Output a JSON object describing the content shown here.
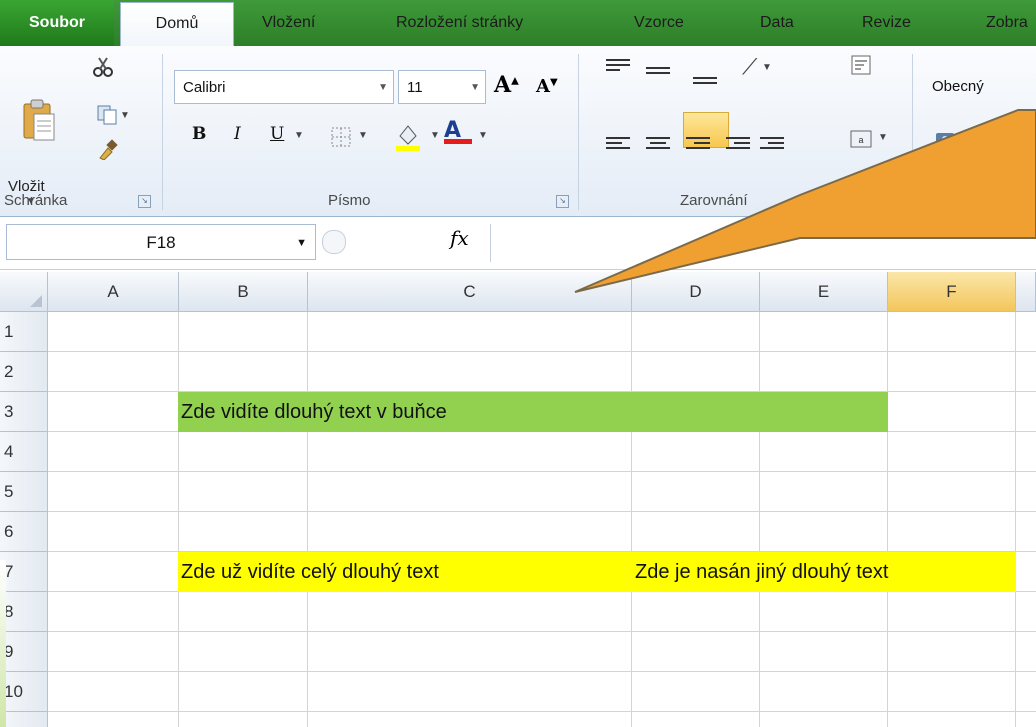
{
  "tabs": [
    "Soubor",
    "Domů",
    "Vložení",
    "Rozložení stránky",
    "Vzorce",
    "Data",
    "Revize",
    "Zobra"
  ],
  "ribbon": {
    "paste_label": "Vložit",
    "groups": {
      "clipboard": "Schránka",
      "font": "Písmo",
      "alignment": "Zarovnání"
    },
    "font_name": "Calibri",
    "font_size": "11",
    "number_format": "Obecný",
    "grow_font": "A",
    "shrink_font": "A",
    "bold": "B",
    "italic": "I",
    "underline": "U",
    "font_color_letter": "A"
  },
  "formula_bar": {
    "name_box": "F18",
    "fx": "fx",
    "formula": ""
  },
  "grid": {
    "columns": [
      "A",
      "B",
      "C",
      "D",
      "E",
      "F"
    ],
    "selected_column": "F",
    "rows": [
      "1",
      "2",
      "3",
      "4",
      "5",
      "6",
      "7",
      "8",
      "9",
      "10"
    ],
    "cells": {
      "b3": "Zde vidíte dlouhý text v buňce",
      "b7": "Zde už vidíte celý dlouhý text",
      "d7": "Zde je nasán jiný dlouhý text"
    }
  },
  "colors": {
    "green_fill": "#92d050",
    "yellow_fill": "#ffff00",
    "callout": "#f0a030",
    "ribbon_green": "#2d7f28"
  },
  "icons": [
    "clipboard-icon",
    "cut-icon",
    "copy-icon",
    "format-painter-icon",
    "borders-icon",
    "fill-color-icon",
    "font-color-icon",
    "wrap-text-icon",
    "merge-icon",
    "currency-icon"
  ]
}
